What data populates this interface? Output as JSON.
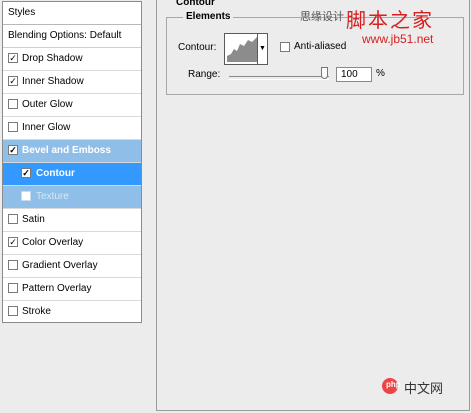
{
  "styles_panel": {
    "header": "Styles",
    "blending_options": "Blending Options: Default",
    "items": [
      {
        "label": "Drop Shadow",
        "checked": true
      },
      {
        "label": "Inner Shadow",
        "checked": true
      },
      {
        "label": "Outer Glow",
        "checked": false
      },
      {
        "label": "Inner Glow",
        "checked": false
      },
      {
        "label": "Bevel and Emboss",
        "checked": true
      },
      {
        "label": "Contour",
        "checked": true
      },
      {
        "label": "Texture",
        "checked": false
      },
      {
        "label": "Satin",
        "checked": false
      },
      {
        "label": "Color Overlay",
        "checked": true
      },
      {
        "label": "Gradient Overlay",
        "checked": false
      },
      {
        "label": "Pattern Overlay",
        "checked": false
      },
      {
        "label": "Stroke",
        "checked": false
      }
    ]
  },
  "contour_section": {
    "title": "Contour",
    "group_title": "Elements",
    "contour_label": "Contour:",
    "anti_aliased_label": "Anti-aliased",
    "anti_aliased_checked": false,
    "range_label": "Range:",
    "range_value": "100",
    "range_unit": "%",
    "range_fraction": 1.0
  },
  "watermark": {
    "text1": "思缘设计",
    "text2": "脚本之家",
    "url": "www.jb51.net",
    "logo_text": "php",
    "logo_label": "中文网"
  },
  "colors": {
    "selected_light": "#8fbfe9",
    "selected_dark": "#3399ff"
  }
}
